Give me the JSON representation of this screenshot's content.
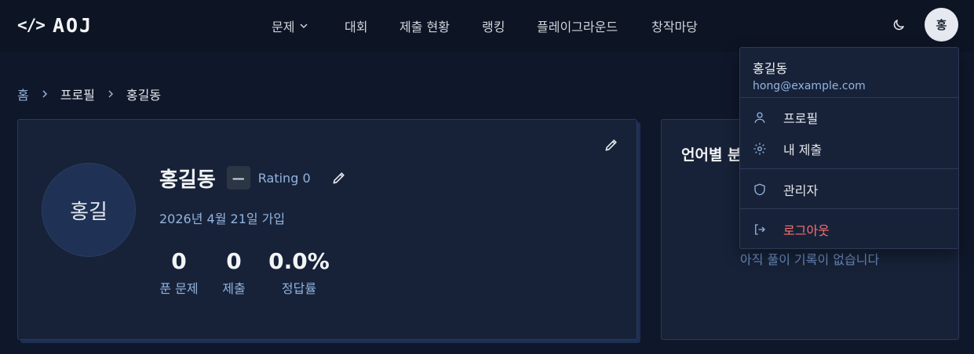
{
  "header": {
    "logo_code": "</>",
    "logo_text": "AOJ",
    "nav": [
      {
        "label": "문제",
        "has_dropdown": true
      },
      {
        "label": "대회"
      },
      {
        "label": "제출 현황"
      },
      {
        "label": "랭킹"
      },
      {
        "label": "플레이그라운드"
      },
      {
        "label": "창작마당"
      }
    ],
    "theme_icon": "moon-icon",
    "avatar_initial": "홍"
  },
  "breadcrumb": [
    "홈",
    "프로필",
    "홍길동"
  ],
  "profile": {
    "avatar_text": "홍길",
    "name": "홍길동",
    "tier_badge": "—",
    "rating": "Rating 0",
    "joined": "2026년 4월 21일 가입",
    "stats": [
      {
        "value": "0",
        "label": "푼 문제"
      },
      {
        "value": "0",
        "label": "제출"
      },
      {
        "value": "0.0%",
        "label": "정답률"
      }
    ]
  },
  "language_card": {
    "title": "언어별 분",
    "empty_text": "아직 풀이 기록이 없습니다"
  },
  "user_menu": {
    "name": "홍길동",
    "email": "hong@example.com",
    "items": [
      {
        "label": "프로필",
        "icon": "user-icon"
      },
      {
        "label": "내 제출",
        "icon": "gear-icon"
      },
      {
        "label": "관리자",
        "icon": "shield-icon"
      },
      {
        "label": "로그아웃",
        "icon": "logout-icon"
      }
    ]
  },
  "colors": {
    "background": "#0f172a",
    "card": "#172238",
    "accent_text": "#93b4e0",
    "danger": "#f87171"
  }
}
